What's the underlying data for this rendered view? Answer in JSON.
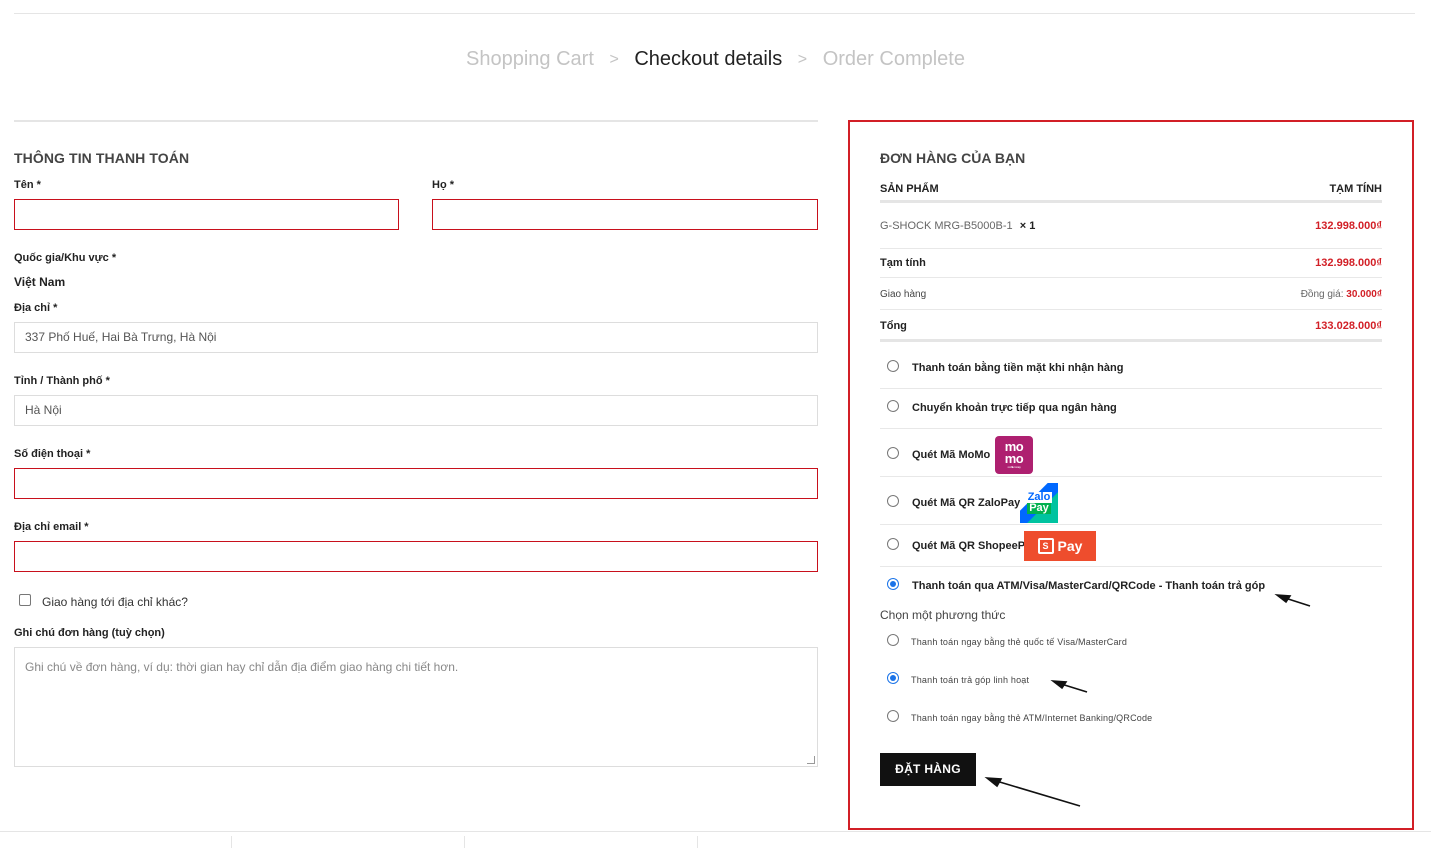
{
  "breadcrumb": {
    "step1": "Shopping Cart",
    "step2": "Checkout details",
    "step3": "Order Complete",
    "separator": ">"
  },
  "billing": {
    "title": "THÔNG TIN THANH TOÁN",
    "first_name_label": "Tên *",
    "first_name_value": "",
    "last_name_label": "Họ *",
    "last_name_value": "",
    "country_label": "Quốc gia/Khu vực *",
    "country_value": "Việt Nam",
    "address_label": "Địa chỉ *",
    "address_value": "337 Phố Huế, Hai Bà Trưng, Hà Nội",
    "city_label": "Tỉnh / Thành phố *",
    "city_value": "Hà Nội",
    "phone_label": "Số điện thoại *",
    "phone_value": "",
    "email_label": "Địa chỉ email *",
    "email_value": "",
    "ship_different_label": "Giao hàng tới địa chỉ khác?",
    "ship_different_checked": false,
    "notes_label": "Ghi chú đơn hàng (tuỳ chọn)",
    "notes_placeholder": "Ghi chú về đơn hàng, ví dụ: thời gian hay chỉ dẫn địa điểm giao hàng chi tiết hơn."
  },
  "order": {
    "title": "ĐƠN HÀNG CỦA BẠN",
    "col_product": "SẢN PHẨM",
    "col_subtotal": "TẠM TÍNH",
    "item_name": "G-SHOCK MRG-B5000B-1",
    "item_qty": "× 1",
    "item_price": "132.998.000₫",
    "subtotal_label": "Tạm tính",
    "subtotal_value": "132.998.000₫",
    "shipping_label": "Giao hàng",
    "shipping_method": "Đồng giá:",
    "shipping_value": "30.000₫",
    "total_label": "Tổng",
    "total_value": "133.028.000₫"
  },
  "payment": {
    "methods": [
      {
        "label": "Thanh toán bằng tiền mặt khi nhận hàng",
        "checked": false
      },
      {
        "label": "Chuyển khoản trực tiếp qua ngân hàng",
        "checked": false
      },
      {
        "label": "Quét Mã MoMo",
        "checked": false,
        "logo": "momo"
      },
      {
        "label": "Quét Mã QR ZaloPay",
        "checked": false,
        "logo": "zalopay"
      },
      {
        "label": "Quét Mã QR ShopeePay",
        "checked": false,
        "logo": "shopeepay"
      },
      {
        "label": "Thanh toán qua ATM/Visa/MasterCard/QRCode - Thanh toán trả góp",
        "checked": true
      }
    ],
    "logos": {
      "momo_line1": "mo",
      "momo_line2": "mo",
      "momo_small": "mobile money",
      "zalo_line1": "Zalo",
      "zalo_line2": "Pay",
      "shopee_bag": "S",
      "shopee_text": "Pay"
    },
    "choose_label": "Chọn một phương thức",
    "sub_options": [
      {
        "label": "Thanh toán ngay bằng thẻ quốc tế Visa/MasterCard",
        "checked": false
      },
      {
        "label": "Thanh toán trả góp linh hoạt",
        "checked": true
      },
      {
        "label": "Thanh toán ngay bằng thẻ ATM/Internet Banking/QRCode",
        "checked": false
      }
    ],
    "place_order": "ĐẶT HÀNG"
  },
  "colors": {
    "accent": "#d21f26",
    "error_border": "#c8101c",
    "radio_checked": "#1a73e8",
    "button_bg": "#111111"
  }
}
